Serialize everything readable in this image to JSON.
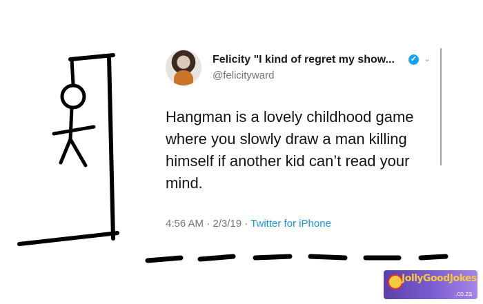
{
  "tweet": {
    "display_name": "Felicity \"I kind of regret my show...",
    "handle": "@felicityward",
    "text": "Hangman is a lovely childhood game where you slowly draw a man killing himself if another kid can’t read your mind.",
    "time": "4:56 AM",
    "date": "2/3/19",
    "source": "Twitter for iPhone",
    "separator": " · ",
    "verified_glyph": "✓",
    "chevron_glyph": "⌄",
    "avatar_icon": "profile-photo"
  },
  "watermark": {
    "logo_text": "JollyGoodJokes",
    "suffix": ".co.za"
  },
  "colors": {
    "link": "#1b95e0",
    "verified": "#1da1f2",
    "meta": "#6b7780",
    "watermark_bg": "#7b5cd0"
  }
}
